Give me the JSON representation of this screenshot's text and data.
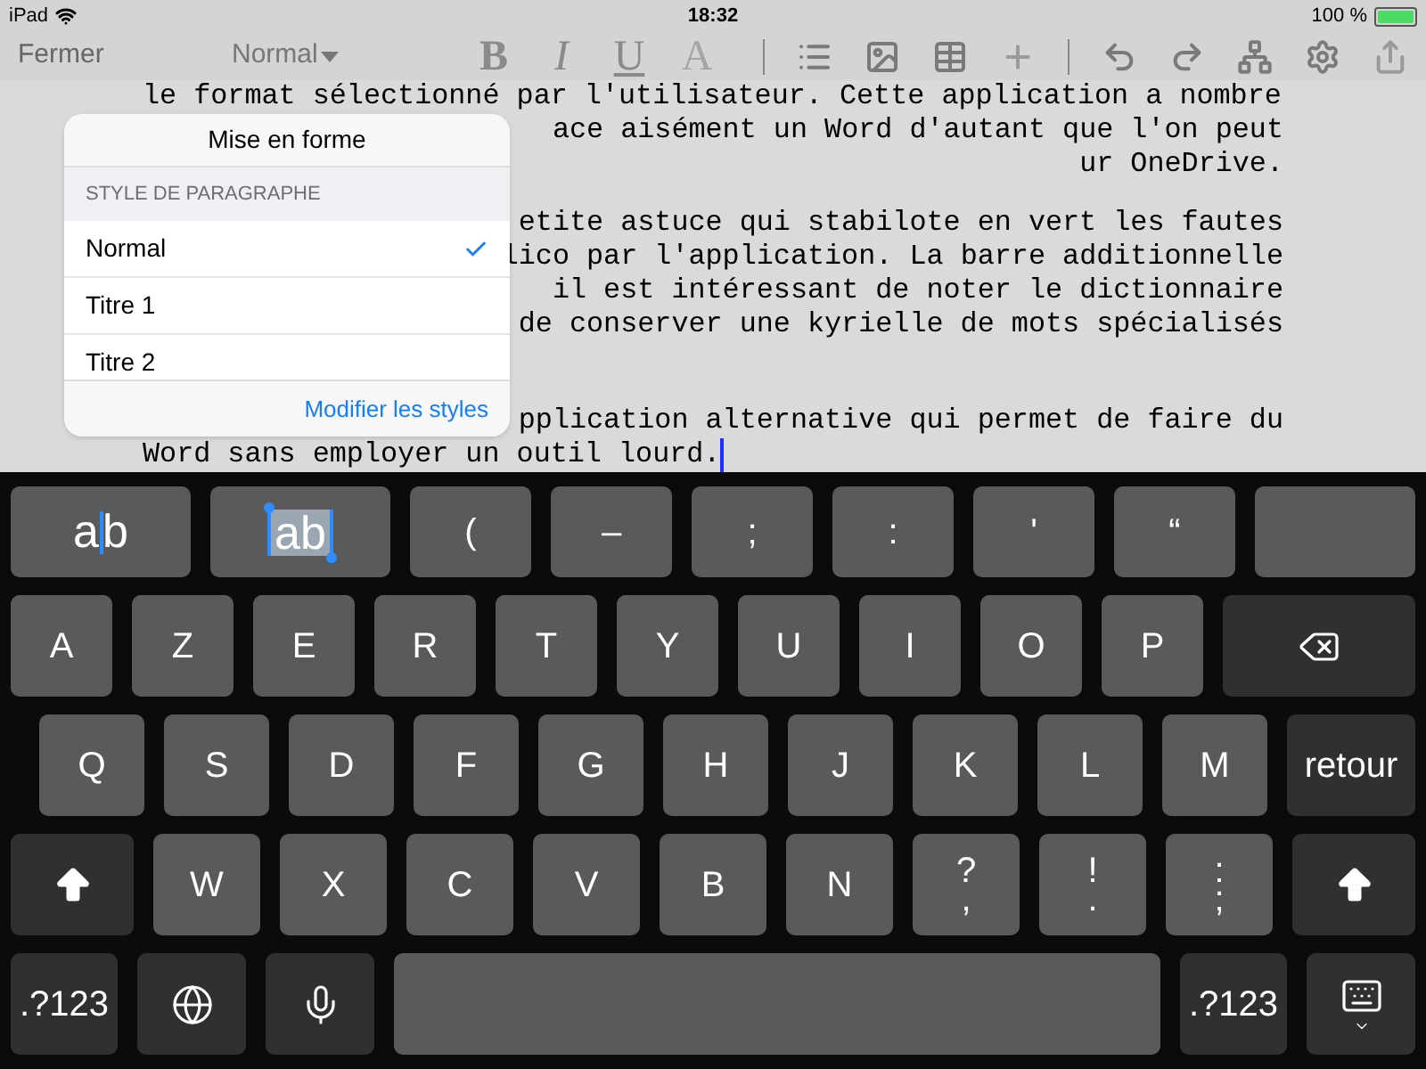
{
  "status_bar": {
    "device": "iPad",
    "time": "18:32",
    "battery": "100 %"
  },
  "toolbar": {
    "close": "Fermer",
    "style_picker": "Normal",
    "format_buttons": [
      {
        "label": "B"
      },
      {
        "label": "I"
      },
      {
        "label": "U"
      },
      {
        "label": "A"
      }
    ]
  },
  "document": {
    "paragraphs": [
      {
        "lines": [
          {
            "text": "le format sélectionné par l'utilisateur. Cette application a nombre",
            "kind": "full",
            "caret": false
          },
          {
            "text": "ace aisément un Word d'autant que l'on peut",
            "kind": "partial",
            "caret": false
          },
          {
            "text": "ur OneDrive.",
            "kind": "partial",
            "caret": false
          }
        ]
      },
      {
        "lines": [
          {
            "text": "etite astuce qui stabilote en vert les fautes",
            "kind": "partial",
            "caret": false
          },
          {
            "text": "lico par l'application. La barre additionnelle",
            "kind": "partial",
            "caret": false
          },
          {
            "text": "il est intéressant de noter le dictionnaire",
            "kind": "partial",
            "caret": false
          },
          {
            "text": "de conserver une kyrielle de mots spécialisés",
            "kind": "partial",
            "caret": false
          }
        ]
      },
      {
        "lines": [
          {
            "text": "pplication alternative qui permet de faire du",
            "kind": "partial",
            "caret": false
          },
          {
            "text": "Word sans employer un outil lourd.",
            "kind": "full",
            "caret": true
          }
        ]
      }
    ]
  },
  "popover": {
    "title": "Mise en forme",
    "section": "STYLE DE PARAGRAPHE",
    "items": [
      {
        "label": "Normal",
        "selected": true
      },
      {
        "label": "Titre 1",
        "selected": false
      },
      {
        "label": "Titre 2",
        "selected": false
      }
    ],
    "footer_link": "Modifier les styles"
  },
  "keyboard": {
    "rows": [
      {
        "keys": [
          {
            "kind": "cursor-sample",
            "label": "ab"
          },
          {
            "kind": "selection-sample",
            "label": "ab"
          },
          {
            "kind": "char",
            "label": "("
          },
          {
            "kind": "char",
            "label": "–"
          },
          {
            "kind": "char",
            "label": ";"
          },
          {
            "kind": "char",
            "label": ":"
          },
          {
            "kind": "char",
            "label": "'"
          },
          {
            "kind": "char",
            "label": "“"
          },
          {
            "kind": "blank"
          }
        ]
      },
      {
        "keys": [
          {
            "kind": "char",
            "label": "A"
          },
          {
            "kind": "char",
            "label": "Z"
          },
          {
            "kind": "char",
            "label": "E"
          },
          {
            "kind": "char",
            "label": "R"
          },
          {
            "kind": "char",
            "label": "T"
          },
          {
            "kind": "char",
            "label": "Y"
          },
          {
            "kind": "char",
            "label": "U"
          },
          {
            "kind": "char",
            "label": "I"
          },
          {
            "kind": "char",
            "label": "O"
          },
          {
            "kind": "char",
            "label": "P"
          },
          {
            "kind": "backspace"
          }
        ]
      },
      {
        "keys": [
          {
            "kind": "char",
            "label": "Q"
          },
          {
            "kind": "char",
            "label": "S"
          },
          {
            "kind": "char",
            "label": "D"
          },
          {
            "kind": "char",
            "label": "F"
          },
          {
            "kind": "char",
            "label": "G"
          },
          {
            "kind": "char",
            "label": "H"
          },
          {
            "kind": "char",
            "label": "J"
          },
          {
            "kind": "char",
            "label": "K"
          },
          {
            "kind": "char",
            "label": "L"
          },
          {
            "kind": "char",
            "label": "M"
          },
          {
            "kind": "return",
            "label": "retour"
          }
        ]
      },
      {
        "keys": [
          {
            "kind": "shift"
          },
          {
            "kind": "char",
            "label": "W"
          },
          {
            "kind": "char",
            "label": "X"
          },
          {
            "kind": "char",
            "label": "C"
          },
          {
            "kind": "char",
            "label": "V"
          },
          {
            "kind": "char",
            "label": "B"
          },
          {
            "kind": "char",
            "label": "N"
          },
          {
            "kind": "dual",
            "label": "?",
            "sub": ","
          },
          {
            "kind": "dual",
            "label": "!",
            "sub": "."
          },
          {
            "kind": "dual",
            "label": ":",
            "sub": ";"
          },
          {
            "kind": "shift"
          }
        ]
      },
      {
        "keys": [
          {
            "kind": "mode",
            "label": ".?123"
          },
          {
            "kind": "globe"
          },
          {
            "kind": "mic"
          },
          {
            "kind": "space"
          },
          {
            "kind": "mode",
            "label": ".?123"
          },
          {
            "kind": "hide"
          }
        ]
      }
    ]
  }
}
